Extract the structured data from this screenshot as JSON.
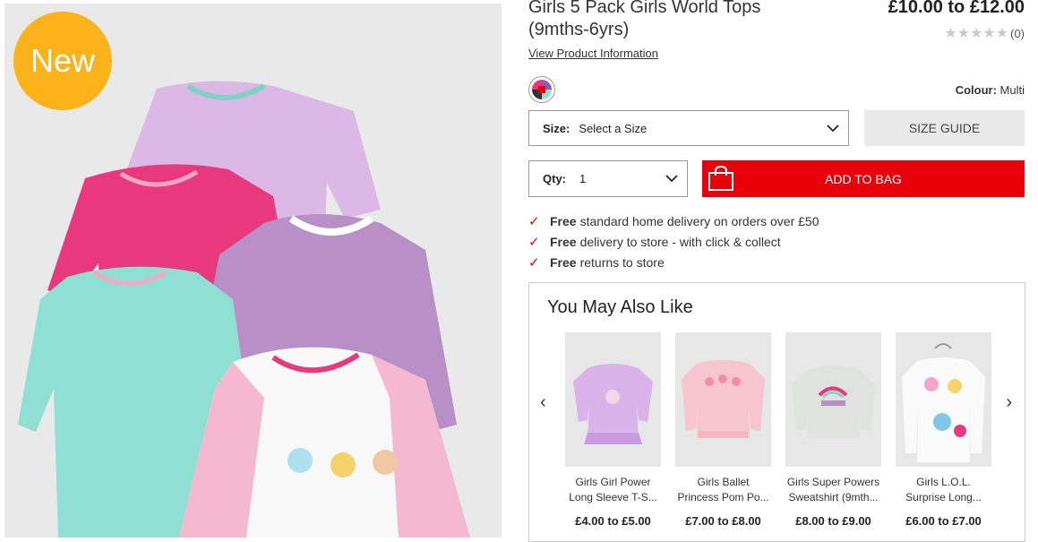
{
  "hero": {
    "badge": "New"
  },
  "product": {
    "title_line1": "Girls 5 Pack Girls World Tops",
    "title_line2": "(9mths-6yrs)",
    "price": "£10.00 to £12.00",
    "rating_count": "(0)",
    "rating_stars": "★★★★★",
    "view_info": "View Product Information",
    "colour_label": "Colour:",
    "colour_value": "Multi"
  },
  "size": {
    "label": "Size:",
    "value": "Select a Size",
    "guide": "SIZE GUIDE"
  },
  "qty": {
    "label": "Qty:",
    "value": "1"
  },
  "cta": {
    "add_to_bag": "ADD TO BAG",
    "color": "#e8000b"
  },
  "benefits": [
    {
      "bold": "Free",
      "text": "standard home delivery on orders over £50"
    },
    {
      "bold": "Free",
      "text": "delivery to store - with click & collect"
    },
    {
      "bold": "Free",
      "text": "returns to store"
    }
  ],
  "ymal": {
    "title": "You May Also Like",
    "prev_icon": "‹",
    "next_icon": "›",
    "items": [
      {
        "line1": "Girls Girl Power",
        "line2": "Long Sleeve T-S...",
        "price": "£4.00 to £5.00"
      },
      {
        "line1": "Girls Ballet",
        "line2": "Princess Pom Po...",
        "price": "£7.00 to £8.00"
      },
      {
        "line1": "Girls Super Powers",
        "line2": "Sweatshirt (9mth...",
        "price": "£8.00 to £9.00"
      },
      {
        "line1": "Girls L.O.L.",
        "line2": "Surprise Long...",
        "price": "£6.00 to £7.00"
      }
    ]
  }
}
